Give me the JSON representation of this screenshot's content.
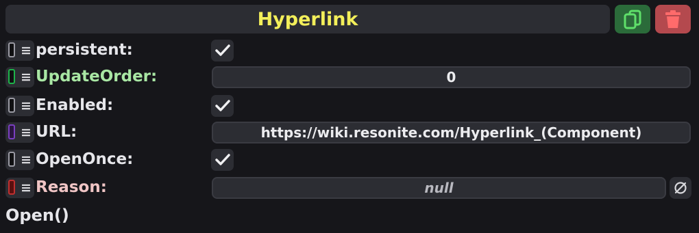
{
  "component": {
    "title": "Hyperlink",
    "title_color": "#f3ef5a",
    "duplicate_icon": "copy-icon",
    "delete_icon": "trash-icon"
  },
  "fields": [
    {
      "label": "persistent:",
      "label_color": "#e6e6ea",
      "type_color": "#101012",
      "type": "checkbox",
      "checked": true
    },
    {
      "label": "UpdateOrder:",
      "label_color": "#a9e7a4",
      "type_color": "#1db44a",
      "type": "value",
      "value": "0"
    },
    {
      "label": "Enabled:",
      "label_color": "#e6e6ea",
      "type_color": "#101012",
      "type": "checkbox",
      "checked": true
    },
    {
      "label": "URL:",
      "label_color": "#e6e6ea",
      "type_color": "#5a2a8a",
      "type": "value",
      "value": "https://wiki.resonite.com/Hyperlink_(Component)"
    },
    {
      "label": "OpenOnce:",
      "label_color": "#e6e6ea",
      "type_color": "#101012",
      "type": "checkbox",
      "checked": true
    },
    {
      "label": "Reason:",
      "label_color": "#f0c5c5",
      "type_color": "#8a1a1a",
      "type": "nullable",
      "value": "null"
    }
  ],
  "method": {
    "label": "Open()"
  },
  "icons": {
    "menu": "≡",
    "check": "check-icon",
    "clear": "null-clear-icon"
  }
}
